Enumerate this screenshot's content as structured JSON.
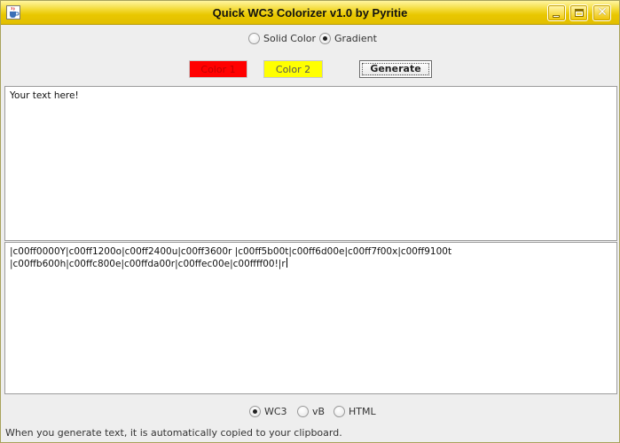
{
  "window": {
    "title": "Quick WC3 Colorizer v1.0 by Pyritie",
    "icon": "java-cup-icon",
    "buttons": [
      "minimize-icon",
      "maximize-icon",
      "close-icon"
    ],
    "close_glyph": "✕"
  },
  "mode": {
    "options": [
      {
        "label": "Solid Color",
        "checked": false
      },
      {
        "label": "Gradient",
        "checked": true
      }
    ]
  },
  "toolbar": {
    "color1_label": "Color 1",
    "color1_value": "#ff0000",
    "color2_label": "Color 2",
    "color2_value": "#ffff00",
    "generate_label": "Generate"
  },
  "input": {
    "value": "Your text here!"
  },
  "output": {
    "lines": [
      "|c00ff0000Y|c00ff1200o|c00ff2400u|c00ff3600r |c00ff5b00t|c00ff6d00e|c00ff7f00x|c00ff9100t",
      "|c00ffb600h|c00ffc800e|c00ffda00r|c00ffec00e|c00ffff00!|r"
    ]
  },
  "format": {
    "options": [
      {
        "label": "WC3",
        "checked": true
      },
      {
        "label": "vB",
        "checked": false
      },
      {
        "label": "HTML",
        "checked": false
      }
    ]
  },
  "status": {
    "text": "When you generate text, it is automatically copied to your clipboard."
  }
}
